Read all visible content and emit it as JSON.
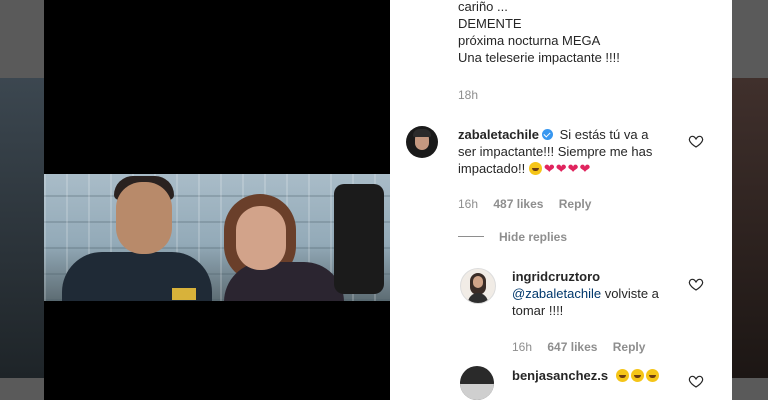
{
  "post_caption": {
    "lines": [
      "cariño ...",
      "DEMENTE",
      "próxima nocturna MEGA",
      "Una teleserie impactante !!!!"
    ],
    "age": "18h"
  },
  "comments": [
    {
      "username": "zabaletachile",
      "verified": true,
      "text_line1": "Si estás tú va a",
      "text_line2": "ser impactante!!! Siempre me has",
      "text_line3": "impactado!!",
      "age": "16h",
      "likes": "487 likes",
      "reply": "Reply",
      "hide_replies": "Hide replies",
      "replies": [
        {
          "username": "ingridcruztoro",
          "mention": "@zabaletachile",
          "text_line1": " volviste a",
          "text_line2": "tomar !!!!",
          "age": "16h",
          "likes": "647 likes",
          "reply": "Reply"
        }
      ]
    },
    {
      "username": "benjasanchez.s"
    }
  ],
  "icons": {
    "like": "heart-outline-icon",
    "verified": "verified-badge-icon",
    "emoji": "crying-laughing-emoji-icon"
  },
  "colors": {
    "text": "#262626",
    "meta": "#8e8e8e",
    "verified": "#3897f0",
    "mention": "#00376b",
    "heart_emoji": "#e0245e"
  }
}
